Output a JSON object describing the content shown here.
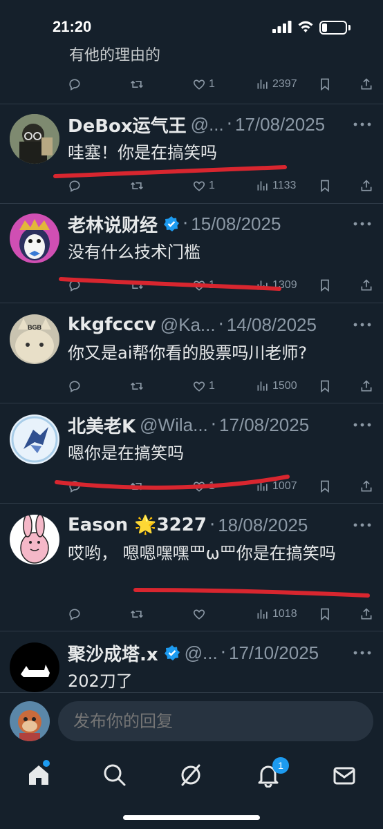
{
  "status": {
    "time": "21:20"
  },
  "partial_tweet": {
    "text": "有他的理由的",
    "actions": {
      "likes": "1",
      "views": "2397"
    }
  },
  "tweets": [
    {
      "name": "DeBox运气王",
      "handle": "@...",
      "date": "17/08/2025",
      "verified": false,
      "text": "哇塞！你是在搞笑吗",
      "likes": "1",
      "views": "1133",
      "avatar_color": "#9aa08a"
    },
    {
      "name": "老林说财经",
      "handle": "",
      "date": "15/08/2025",
      "verified": true,
      "text": "没有什么技术门槛",
      "likes": "1",
      "views": "1309",
      "avatar_color": "#d04fb3"
    },
    {
      "name": "kkgfcccv",
      "handle": "@Ka...",
      "date": "14/08/2025",
      "verified": false,
      "text": "你又是ai帮你看的股票吗川老师?",
      "likes": "1",
      "views": "1500",
      "avatar_color": "#c9c3b0",
      "avatar_text": "BGB"
    },
    {
      "name": "北美老K",
      "handle": "@Wila...",
      "date": "17/08/2025",
      "verified": false,
      "text": "嗯你是在搞笑吗",
      "likes": "1",
      "views": "1007",
      "avatar_color": "#e8f2fb"
    },
    {
      "name": "Eason 🌟3227",
      "handle": "",
      "date": "18/08/2025",
      "verified": false,
      "text": "哎哟， 嗯嗯嘿嘿罒ω罒你是在搞笑吗",
      "likes": "",
      "views": "1018",
      "avatar_color": "#ffffff"
    },
    {
      "name": "聚沙成塔.x",
      "handle": "@...",
      "date": "17/10/2025",
      "verified": true,
      "text": "202刀了",
      "likes": "",
      "views": "",
      "avatar_color": "#000000"
    }
  ],
  "reply": {
    "placeholder": "发布你的回复"
  },
  "nav": {
    "notifications_badge": "1"
  },
  "colors": {
    "background": "#15202b",
    "accent": "#1d9bf0",
    "muted": "#8b98a5",
    "annotation": "#d8262f"
  }
}
